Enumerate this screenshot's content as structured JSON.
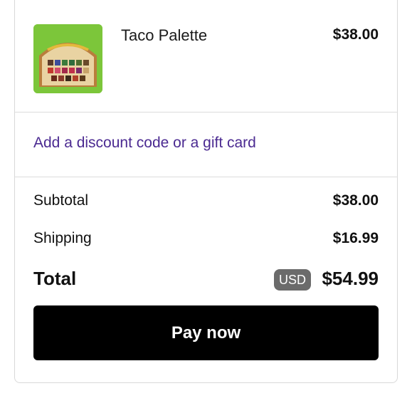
{
  "item": {
    "name": "Taco Palette",
    "price": "$38.00",
    "image_icon": "taco-palette-product-image"
  },
  "discount": {
    "link_label": "Add a discount code or a gift card"
  },
  "summary": {
    "subtotal_label": "Subtotal",
    "subtotal_value": "$38.00",
    "shipping_label": "Shipping",
    "shipping_value": "$16.99",
    "total_label": "Total",
    "currency": "USD",
    "total_value": "$54.99"
  },
  "actions": {
    "pay_label": "Pay now"
  },
  "colors": {
    "link": "#4b2a91",
    "pay_button_bg": "#000000",
    "badge_bg": "#6b6b6b"
  }
}
